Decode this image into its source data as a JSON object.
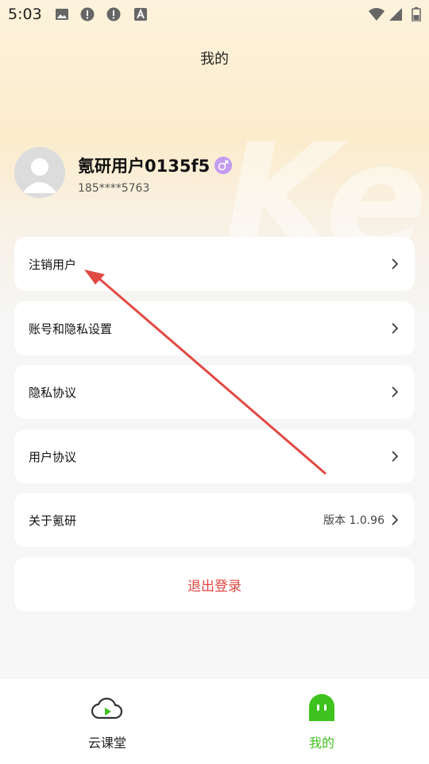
{
  "status_bar": {
    "time": "5:03",
    "icons": [
      "image-icon",
      "alert-icon",
      "alert-icon",
      "font-icon",
      "wifi-icon",
      "signal-icon",
      "battery-icon"
    ]
  },
  "page": {
    "title": "我的"
  },
  "profile": {
    "username": "氪研用户0135f5",
    "phone": "185****5763",
    "gender_icon": "male-icon",
    "gender_color": "#c39bf0"
  },
  "menu": [
    {
      "label": "注销用户"
    },
    {
      "label": "账号和隐私设置"
    },
    {
      "label": "隐私协议"
    },
    {
      "label": "用户协议"
    },
    {
      "label": "关于氪研",
      "value": "版本 1.0.96"
    }
  ],
  "logout": {
    "label": "退出登录",
    "color": "#e2463f"
  },
  "tabs": [
    {
      "label": "云课堂",
      "icon": "cloud-play-icon",
      "active": false
    },
    {
      "label": "我的",
      "icon": "ghost-icon",
      "active": true
    }
  ],
  "colors": {
    "accent": "#3ec21d",
    "annotation": "#e24a44"
  }
}
